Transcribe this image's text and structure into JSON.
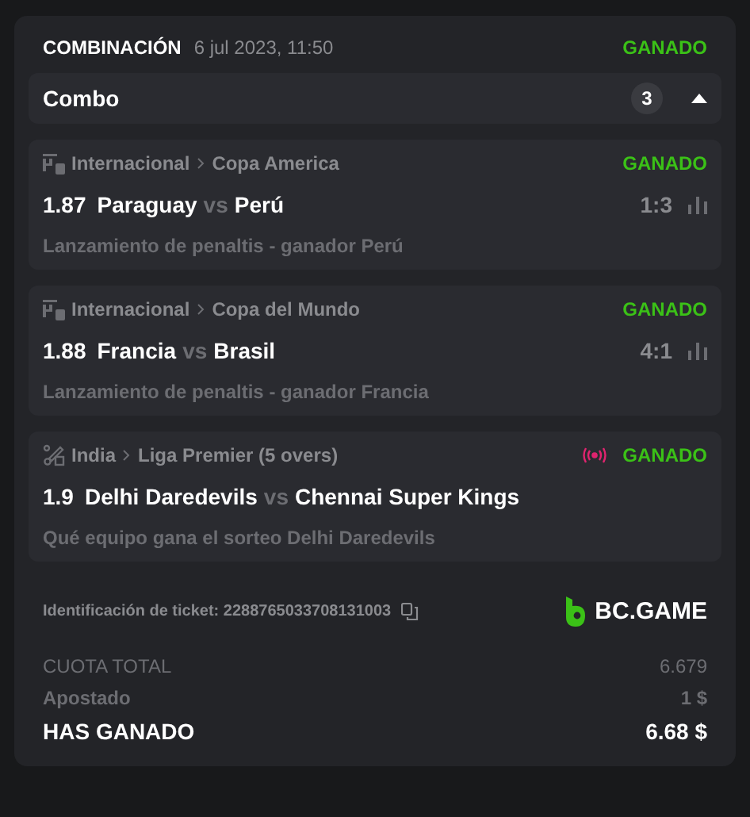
{
  "header": {
    "title": "COMBINACIÓN",
    "date": "6 jul 2023, 11:50",
    "status": "GANADO"
  },
  "combo": {
    "label": "Combo",
    "count": "3",
    "expanded": true
  },
  "bets": [
    {
      "kind": "esoccer",
      "country": "Internacional",
      "league": "Copa America",
      "live": false,
      "status": "GANADO",
      "odds": "1.87",
      "home": "Paraguay",
      "vs": "vs",
      "away": "Perú",
      "score": "1:3",
      "stats": true,
      "market": "Lanzamiento de penaltis - ganador Perú"
    },
    {
      "kind": "esoccer",
      "country": "Internacional",
      "league": "Copa del Mundo",
      "live": false,
      "status": "GANADO",
      "odds": "1.88",
      "home": "Francia",
      "vs": "vs",
      "away": "Brasil",
      "score": "4:1",
      "stats": true,
      "market": "Lanzamiento de penaltis - ganador Francia"
    },
    {
      "kind": "cricket",
      "country": "India",
      "league": "Liga Premier (5 overs)",
      "live": true,
      "status": "GANADO",
      "odds": "1.9",
      "home": "Delhi Daredevils",
      "vs": "vs",
      "away": "Chennai Super Kings",
      "stats": false,
      "market": "Qué equipo gana el sorteo Delhi Daredevils"
    }
  ],
  "ticket": {
    "label": "Identificación de ticket: 2288765033708131003",
    "brand": "BC.GAME"
  },
  "summary": [
    {
      "kind": "muted",
      "label": "CUOTA TOTAL",
      "value": "6.679"
    },
    {
      "kind": "plain",
      "label": "Apostado",
      "value": "1 $"
    },
    {
      "kind": "total",
      "label": "HAS GANADO",
      "value": "6.68 $"
    }
  ]
}
